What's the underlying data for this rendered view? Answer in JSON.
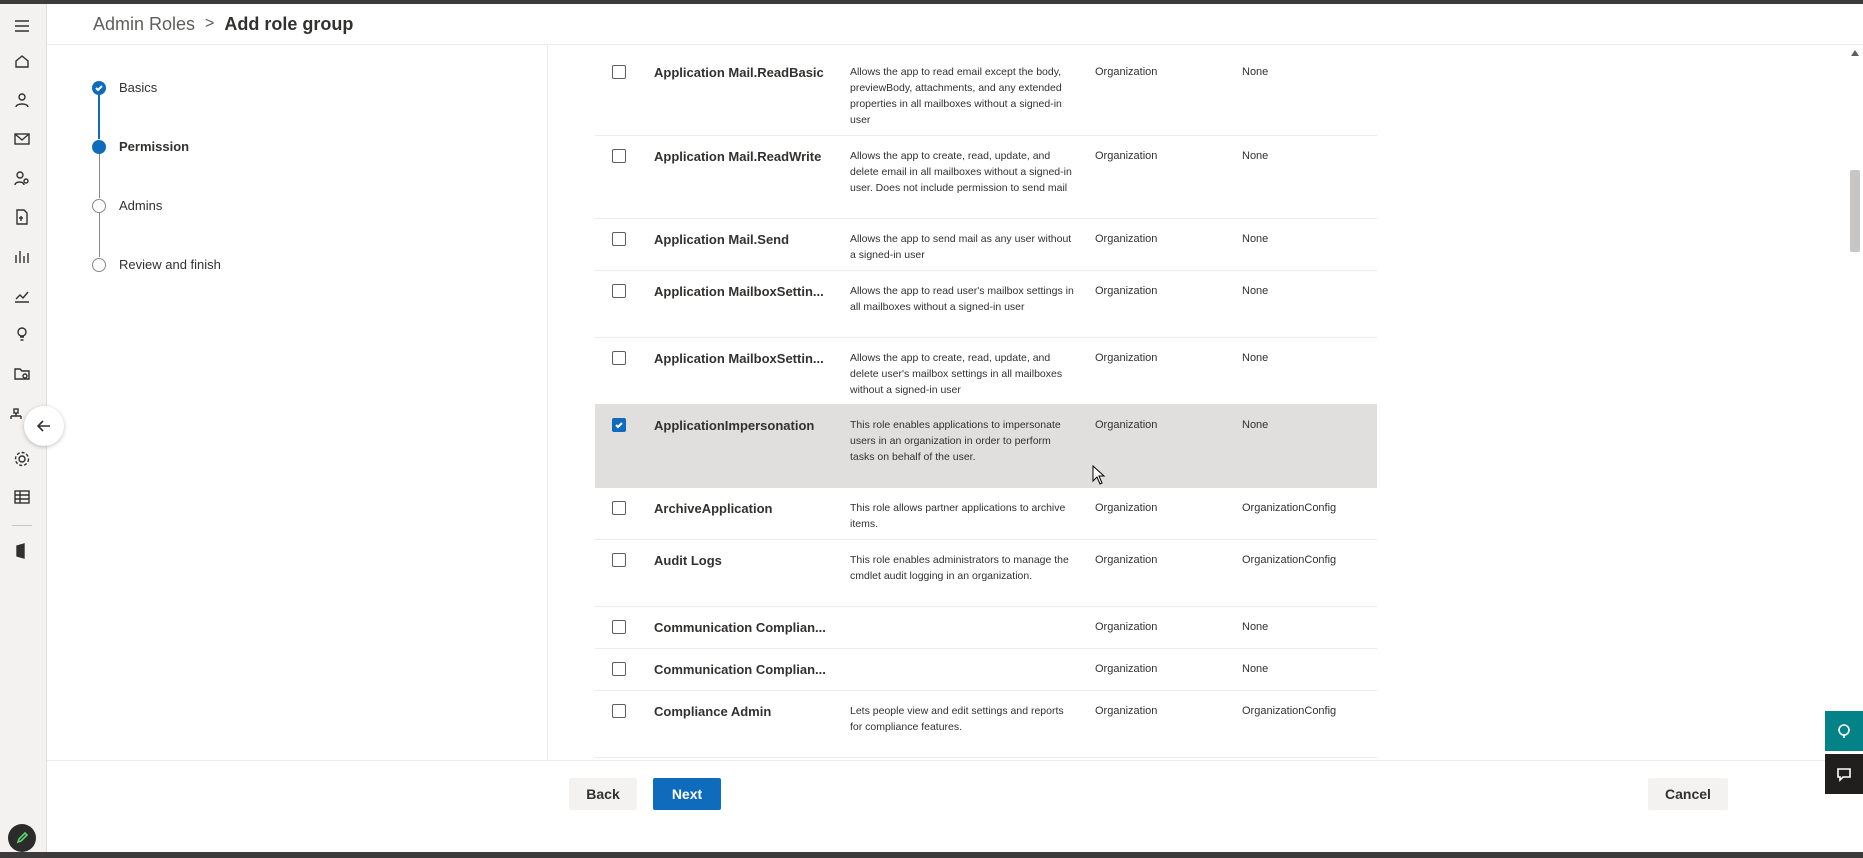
{
  "breadcrumb": {
    "parent": "Admin Roles",
    "separator": ">",
    "current": "Add role group"
  },
  "steps": [
    {
      "label": "Basics",
      "state": "done"
    },
    {
      "label": "Permission",
      "state": "current"
    },
    {
      "label": "Admins",
      "state": "todo"
    },
    {
      "label": "Review and finish",
      "state": "todo"
    }
  ],
  "rail_icons": [
    "menu-icon",
    "home-icon",
    "user-icon",
    "mail-icon",
    "users-admin-icon",
    "document-icon",
    "reports-icon",
    "analytics-icon",
    "lightbulb-icon",
    "folder-settings-icon",
    "org-chart-icon",
    "settings-icon",
    "table-icon",
    "office-icon"
  ],
  "permissions": [
    {
      "name": "Application Mail.ReadBasic",
      "desc": "Allows the app to read email except the body, previewBody, attachments, and any extended properties in all mailboxes without a signed-in user",
      "scope": "Organization",
      "write": "None",
      "checked": false
    },
    {
      "name": "Application Mail.ReadWrite",
      "desc": "Allows the app to create, read, update, and delete email in all mailboxes without a signed-in user. Does not include permission to send mail",
      "scope": "Organization",
      "write": "None",
      "checked": false
    },
    {
      "name": "Application Mail.Send",
      "desc": "Allows the app to send mail as any user without a signed-in user",
      "scope": "Organization",
      "write": "None",
      "checked": false
    },
    {
      "name": "Application MailboxSettin...",
      "desc": "Allows the app to read user's mailbox settings in all mailboxes without a signed-in user",
      "scope": "Organization",
      "write": "None",
      "checked": false
    },
    {
      "name": "Application MailboxSettin...",
      "desc": "Allows the app to create, read, update, and delete user's mailbox settings in all mailboxes without a signed-in user",
      "scope": "Organization",
      "write": "None",
      "checked": false
    },
    {
      "name": "ApplicationImpersonation",
      "desc": "This role enables applications to impersonate users in an organization in order to perform tasks on behalf of the user.",
      "scope": "Organization",
      "write": "None",
      "checked": true
    },
    {
      "name": "ArchiveApplication",
      "desc": "This role allows partner applications to archive items.",
      "scope": "Organization",
      "write": "OrganizationConfig",
      "checked": false
    },
    {
      "name": "Audit Logs",
      "desc": "This role enables administrators to manage the cmdlet audit logging in an organization.",
      "scope": "Organization",
      "write": "OrganizationConfig",
      "checked": false
    },
    {
      "name": "Communication Complian...",
      "desc": "",
      "scope": "Organization",
      "write": "None",
      "checked": false
    },
    {
      "name": "Communication Complian...",
      "desc": "",
      "scope": "Organization",
      "write": "None",
      "checked": false
    },
    {
      "name": "Compliance Admin",
      "desc": "Lets people view and edit settings and reports for compliance features.",
      "scope": "Organization",
      "write": "OrganizationConfig",
      "checked": false
    }
  ],
  "footer": {
    "back": "Back",
    "next": "Next",
    "cancel": "Cancel"
  },
  "colors": {
    "accent": "#0f6cbd",
    "selected_row": "#e1dfdd",
    "teal_button": "#038387",
    "dark_button": "#201f1e"
  }
}
